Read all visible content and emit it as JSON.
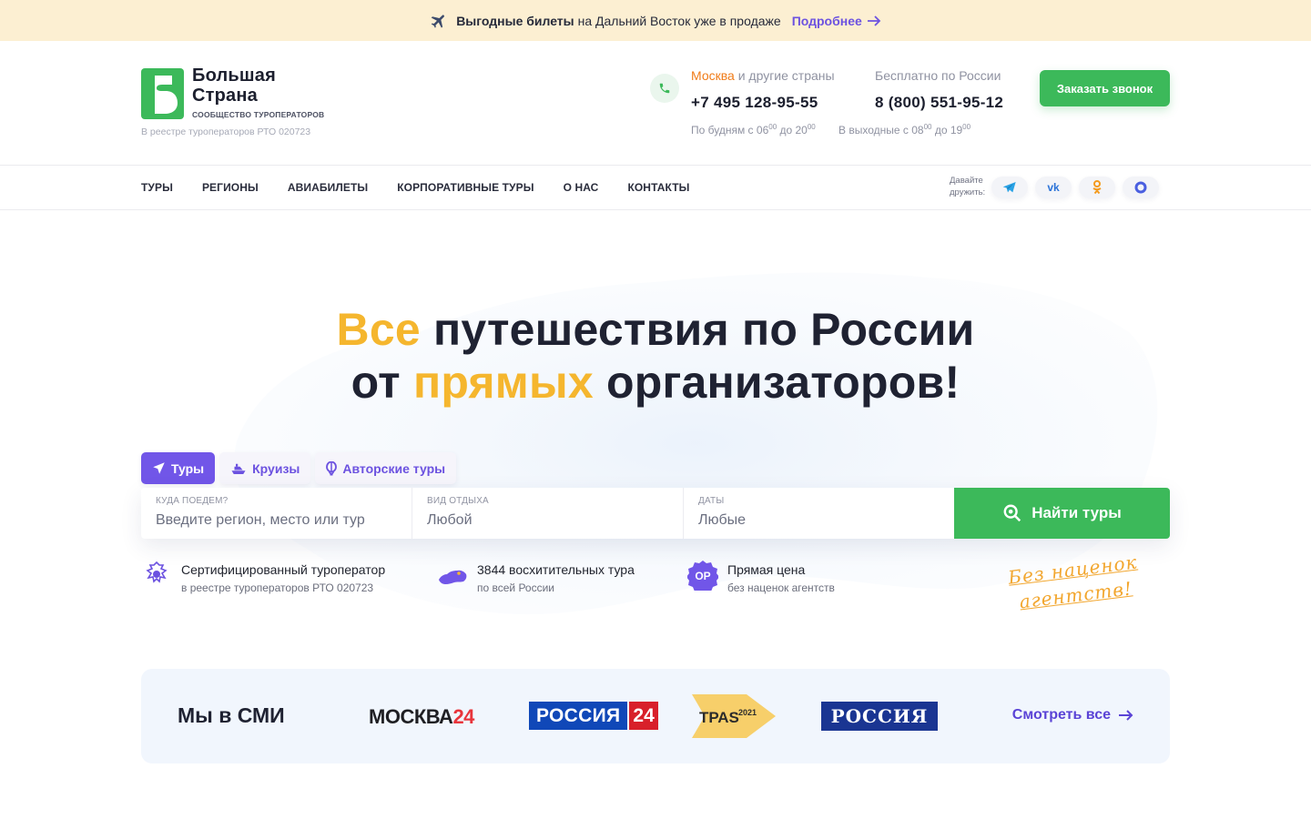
{
  "promo": {
    "bold": "Выгодные билеты",
    "text": "на Дальний Восток уже в продаже",
    "link": "Подробнее"
  },
  "header": {
    "logo_line1": "Большая",
    "logo_line2": "Страна",
    "logo_sub": "СООБЩЕСТВО ТУРОПЕРАТОРОВ",
    "registry": "В реестре туроператоров РТО 020723",
    "phone1": {
      "city_highlight": "Москва",
      "city_rest": "и другие страны",
      "number": "+7 495 128-95-55",
      "hours_prefix": "По будням с 06",
      "hours_sup1": "00",
      "hours_mid": "до 20",
      "hours_sup2": "00"
    },
    "phone2": {
      "label": "Бесплатно по России",
      "number": "8 (800) 551-95-12",
      "hours_prefix": "В выходные с 08",
      "hours_sup1": "00",
      "hours_mid": "до 19",
      "hours_sup2": "00"
    },
    "call_button": "Заказать звонок"
  },
  "nav": {
    "items": [
      "ТУРЫ",
      "РЕГИОНЫ",
      "АВИАБИЛЕТЫ",
      "КОРПОРАТИВНЫЕ ТУРЫ",
      "О НАС",
      "КОНТАКТЫ"
    ],
    "social_label_1": "Давайте",
    "social_label_2": "дружить:",
    "socials": [
      "telegram-icon",
      "vk-icon",
      "odnoklassniki-icon",
      "max-icon"
    ]
  },
  "hero": {
    "line1_highlight": "Все",
    "line1_rest": "путешествия по России",
    "line2_start": "от",
    "line2_highlight": "прямых",
    "line2_end": "организаторов!"
  },
  "tabs": [
    {
      "label": "Туры",
      "icon": "send-icon",
      "active": true
    },
    {
      "label": "Круизы",
      "icon": "ship-icon",
      "active": false
    },
    {
      "label": "Авторские туры",
      "icon": "balloon-icon",
      "active": false
    }
  ],
  "search": {
    "where_label": "КУДА ПОЕДЕМ?",
    "where_placeholder": "Введите регион, место или тур",
    "type_label": "ВИД ОТДЫХА",
    "type_value": "Любой",
    "dates_label": "ДАТЫ",
    "dates_value": "Любые",
    "button": "Найти туры"
  },
  "features": [
    {
      "title": "Сертифицированный туроператор",
      "sub": "в реестре туроператоров РТО 020723",
      "icon": "emblem-icon"
    },
    {
      "title": "3844 восхитительных тура",
      "sub": "по всей России",
      "icon": "russia-map-icon"
    },
    {
      "title": "Прямая цена",
      "sub": "без наценок агентств",
      "icon": "op-badge-icon",
      "badge": "OP"
    }
  ],
  "slogan": {
    "line1": "Без наценок",
    "line2": "агентств!"
  },
  "media": {
    "title": "Мы в СМИ",
    "moskva24_a": "МОСКВА",
    "moskva24_b": "24",
    "rossia24_a": "РОССИЯ",
    "rossia24_b": "24",
    "tass": "ТРАS",
    "tass_year": "2021",
    "rossia": "РОССИЯ",
    "see_all": "Смотреть все"
  },
  "colors": {
    "accent_green": "#3cb95a",
    "accent_purple": "#7156e8",
    "accent_yellow": "#f5b62e",
    "promo_bg": "#fcefd2"
  }
}
